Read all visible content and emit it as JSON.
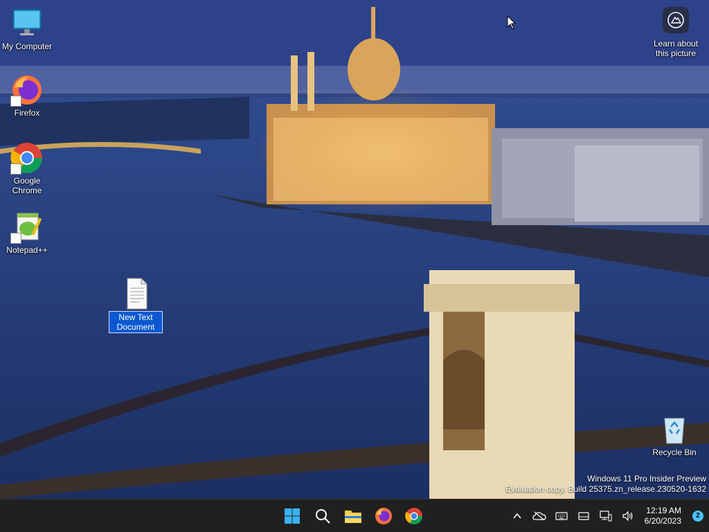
{
  "desktop": {
    "icons": [
      {
        "label": "My Computer"
      },
      {
        "label": "Firefox"
      },
      {
        "label": "Google Chrome"
      },
      {
        "label": "Notepad++"
      },
      {
        "label": "New Text Document"
      },
      {
        "label": "Learn about this picture"
      },
      {
        "label": "Recycle Bin"
      }
    ]
  },
  "watermark": {
    "line1": "Windows 11 Pro Insider Preview",
    "line2": "Evaluation copy. Build 25375.zn_release.230520-1632"
  },
  "taskbar": {
    "apps": [
      {
        "icon": "windows-start-icon"
      },
      {
        "icon": "search-icon"
      },
      {
        "icon": "file-explorer-icon"
      },
      {
        "icon": "firefox-icon"
      },
      {
        "icon": "chrome-icon"
      }
    ],
    "tray": {
      "time": "12:19 AM",
      "date": "6/20/2023",
      "notification_count": "2"
    }
  },
  "colors": {
    "taskbar_bg": "#202020",
    "selection": "#0a58d2",
    "badge": "#4cc2ff"
  }
}
